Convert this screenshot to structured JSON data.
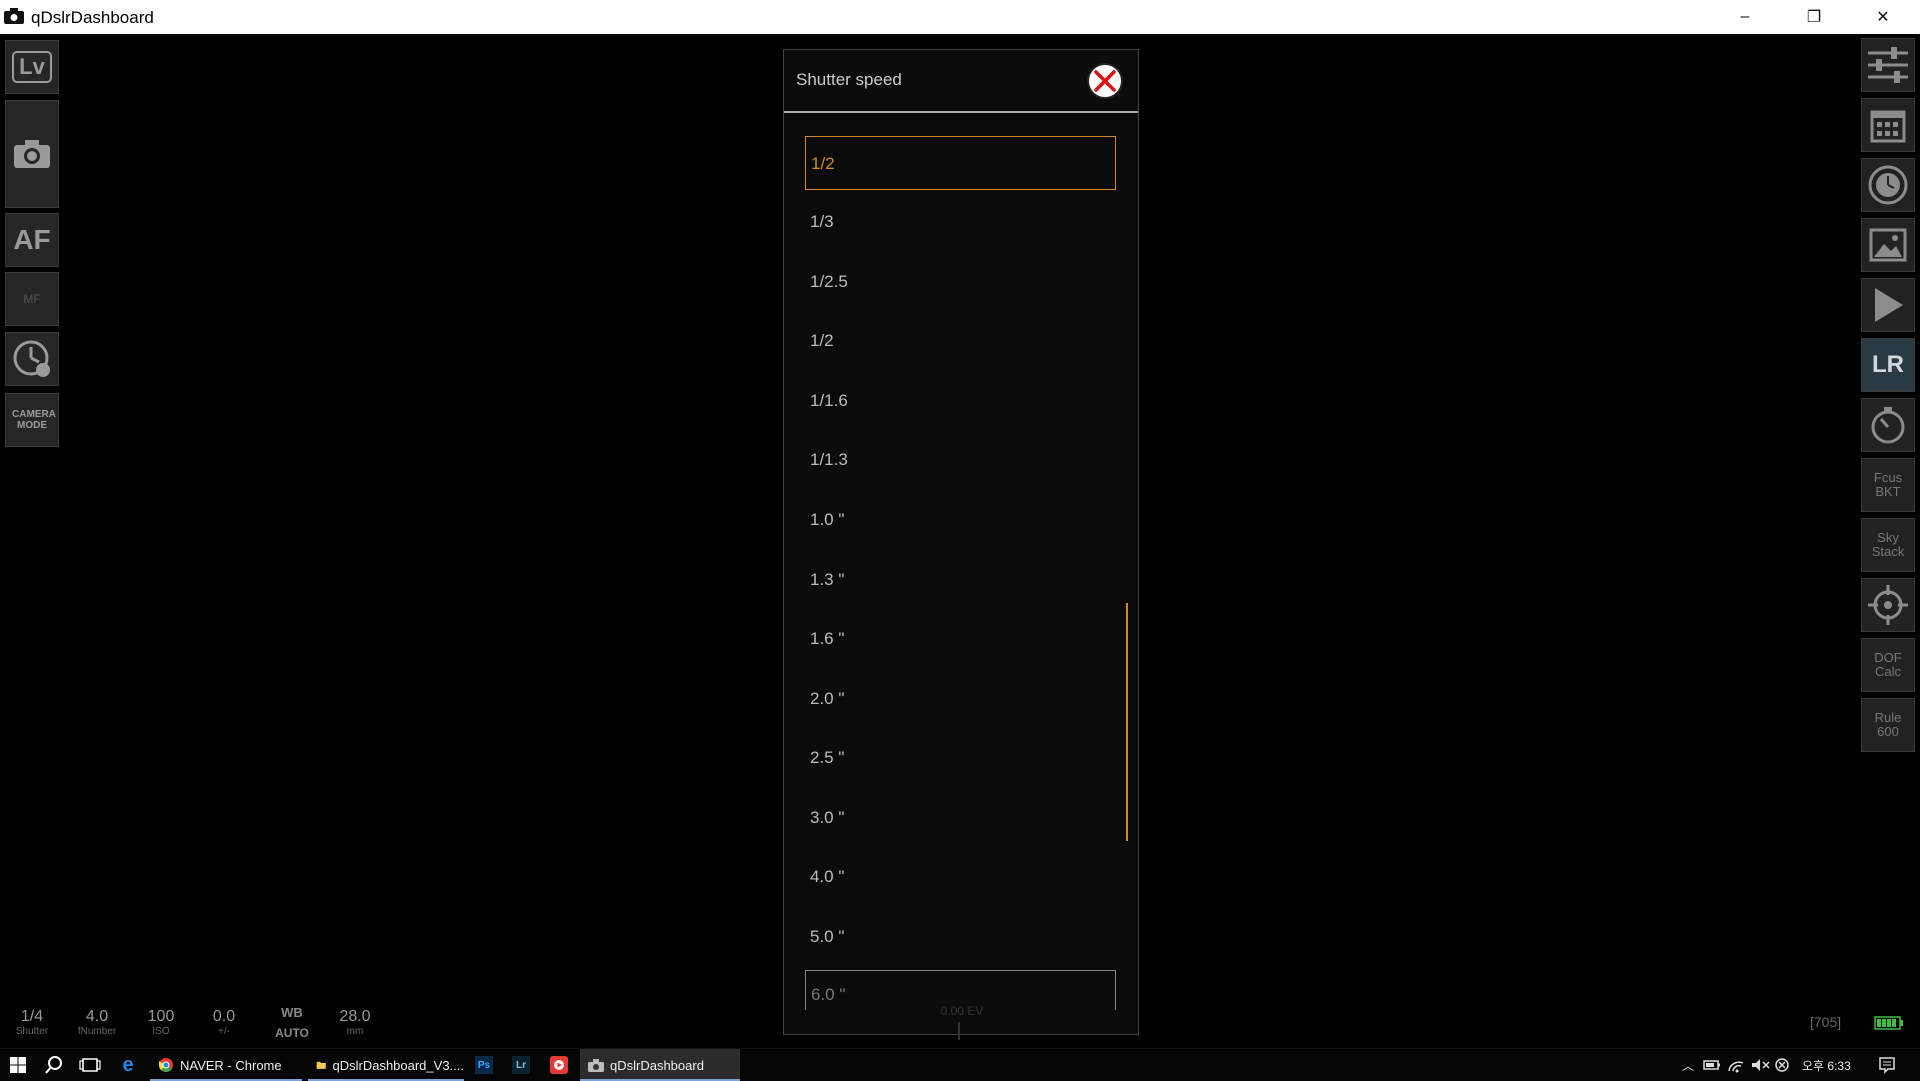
{
  "window": {
    "title": "qDslrDashboard",
    "minimize": "–",
    "restore": "❐",
    "close": "✕"
  },
  "left_toolbar": [
    {
      "id": "liveview",
      "label": "Lv",
      "icon": "liveview-icon"
    },
    {
      "id": "capture",
      "label": "",
      "icon": "camera-icon"
    },
    {
      "id": "autofocus",
      "label": "AF",
      "icon": "af-icon"
    },
    {
      "id": "focus-mode",
      "label": "MF",
      "icon": "focus-mode-icon"
    },
    {
      "id": "timer",
      "label": "",
      "icon": "timer-icon"
    },
    {
      "id": "camera-mode",
      "label": "CAMERA MODE",
      "icon": "camera-mode-icon"
    }
  ],
  "right_toolbar": [
    {
      "id": "settings",
      "label": "",
      "icon": "sliders-icon"
    },
    {
      "id": "calendar",
      "label": "",
      "icon": "calendar-icon"
    },
    {
      "id": "intervalometer",
      "label": "",
      "icon": "clock-icon"
    },
    {
      "id": "gallery",
      "label": "",
      "icon": "image-icon"
    },
    {
      "id": "play",
      "label": "",
      "icon": "play-icon"
    },
    {
      "id": "lrtimelapse",
      "label": "LR",
      "icon": "lrtimelapse-icon"
    },
    {
      "id": "stopwatch",
      "label": "",
      "icon": "stopwatch-icon"
    },
    {
      "id": "focus-bkt",
      "label": "Fcus BKT",
      "icon": "text"
    },
    {
      "id": "sky-stack",
      "label": "Sky Stack",
      "icon": "text"
    },
    {
      "id": "target",
      "label": "",
      "icon": "crosshair-icon"
    },
    {
      "id": "dof-calc",
      "label": "DOF Calc",
      "icon": "text"
    },
    {
      "id": "rule-600",
      "label": "Rule 600",
      "icon": "text"
    }
  ],
  "dialog": {
    "title": "Shutter speed",
    "options": [
      "1/2",
      "1/3",
      "1/2.5",
      "1/2",
      "1/1.6",
      "1/1.3",
      "1.0 \"",
      "1.3 \"",
      "1.6 \"",
      "2.0 \"",
      "2.5 \"",
      "3.0 \"",
      "4.0 \"",
      "5.0 \"",
      "6.0 \""
    ],
    "selected_index": 0
  },
  "bottom_status": [
    {
      "id": "shutter",
      "value": "1/4",
      "label": "Shutter"
    },
    {
      "id": "fnumber",
      "value": "4.0",
      "label": "fNumber"
    },
    {
      "id": "iso",
      "value": "100",
      "label": "ISO"
    },
    {
      "id": "ev",
      "value": "0.0",
      "label": "+/-"
    },
    {
      "id": "wb",
      "value": "WB",
      "label": "AUTO"
    },
    {
      "id": "focal",
      "value": "28.0",
      "label": "mm"
    }
  ],
  "center_readout": "0.00 EV",
  "shots_remaining": "[705]",
  "colors": {
    "accent": "#d08a1a",
    "close_red": "#e01010",
    "battery": "#3fbf3f"
  },
  "taskbar": {
    "items": [
      {
        "label": "NAVER - Chrome",
        "icon": "chrome-icon"
      },
      {
        "label": "qDslrDashboard_V3....",
        "icon": "folder-icon"
      },
      {
        "label": "qDslrDashboard",
        "icon": "camera-icon"
      }
    ],
    "pinned": [
      "Ps",
      "Lr"
    ],
    "clock": "오후 6:33"
  }
}
